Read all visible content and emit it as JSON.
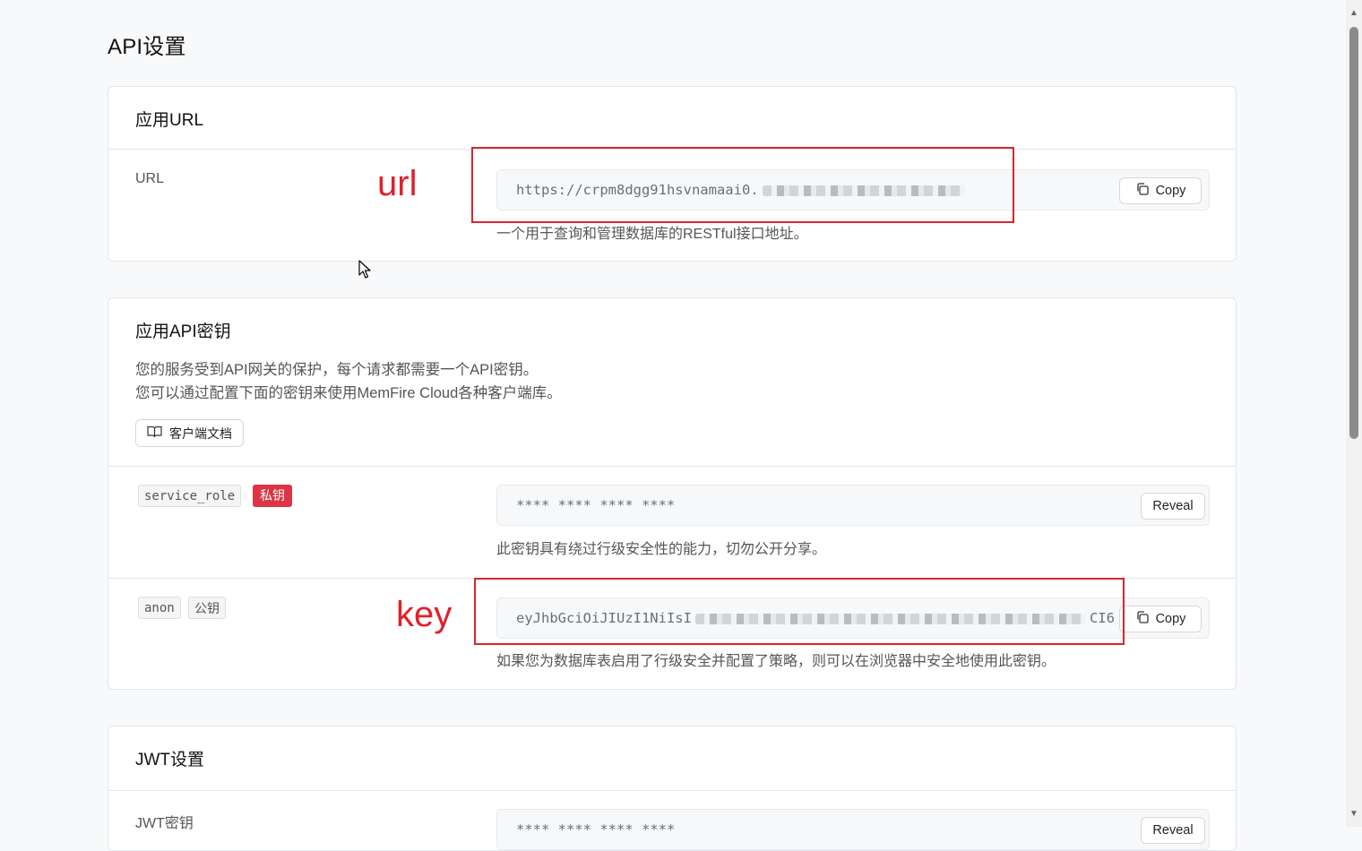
{
  "page": {
    "title": "API设置"
  },
  "url_card": {
    "title": "应用URL",
    "label": "URL",
    "value": "https://crpm8dgg91hsvnamaai0.",
    "copy_label": "Copy",
    "help": "一个用于查询和管理数据库的RESTful接口地址。"
  },
  "keys_card": {
    "title": "应用API密钥",
    "desc_line1": "您的服务受到API网关的保护，每个请求都需要一个API密钥。",
    "desc_line2": "您可以通过配置下面的密钥来使用MemFire Cloud各种客户端库。",
    "docs_button": "客户端文档",
    "service_role": {
      "name": "service_role",
      "badge": "私钥",
      "masked_value": "**** **** **** ****",
      "reveal_label": "Reveal",
      "help": "此密钥具有绕过行级安全性的能力，切勿公开分享。"
    },
    "anon": {
      "name": "anon",
      "badge": "公钥",
      "value_start": "eyJhbGciOiJIUzI1NiIsI",
      "value_end": "CI6",
      "copy_label": "Copy",
      "help": "如果您为数据库表启用了行级安全并配置了策略，则可以在浏览器中安全地使用此密钥。"
    }
  },
  "jwt_card": {
    "title": "JWT设置",
    "label": "JWT密钥",
    "masked_value": "**** **** **** ****",
    "reveal_label": "Reveal"
  },
  "annotations": {
    "url_label": "url",
    "key_label": "key",
    "color": "#d9262c"
  }
}
